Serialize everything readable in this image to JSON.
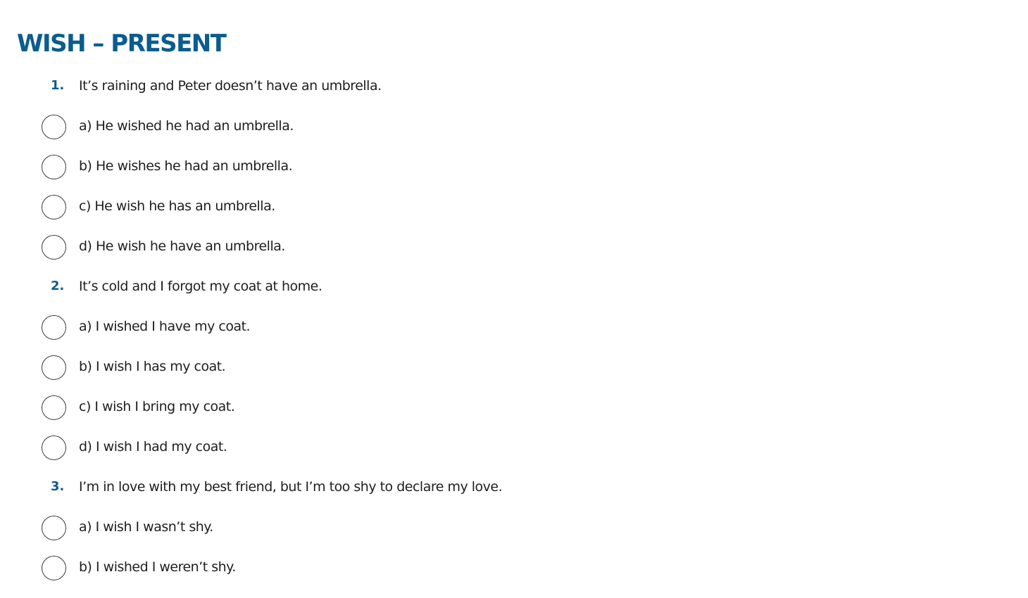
{
  "page": {
    "title": "WISH – PRESENT"
  },
  "questions": [
    {
      "number": "1.",
      "text": "It’s raining and Peter doesn’t have an umbrella.",
      "options": [
        "a) He wished he had an umbrella.",
        "b) He wishes he had an umbrella.",
        "c) He wish he has an umbrella.",
        "d) He wish he have an umbrella."
      ]
    },
    {
      "number": "2.",
      "text": "It’s cold and I forgot my coat at home.",
      "options": [
        "a) I wished I have my coat.",
        "b) I wish I has my coat.",
        "c) I wish I bring my coat.",
        "d) I wish I had my coat."
      ]
    },
    {
      "number": "3.",
      "text": "I’m in love with my best friend, but I’m too shy to declare my love.",
      "options": [
        "a) I wish I wasn’t shy.",
        "b) I wished I weren’t shy."
      ]
    }
  ],
  "colors": {
    "accent": "#0b5c8f",
    "text": "#1e1e1e",
    "radio_border": "#3a3a3a"
  }
}
